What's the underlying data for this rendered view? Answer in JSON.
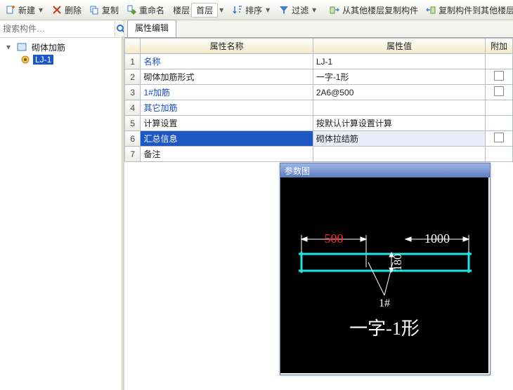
{
  "toolbar": {
    "new": "新建",
    "delete": "删除",
    "copy": "复制",
    "rename": "重命名",
    "floor_label": "楼层",
    "floor_value": "首层",
    "sort": "排序",
    "filter": "过滤",
    "copy_from": "从其他楼层复制构件",
    "copy_to": "复制构件到其他楼层"
  },
  "sidebar": {
    "search_placeholder": "搜索构件…",
    "root": "砌体加筋",
    "item": "LJ-1"
  },
  "tab": {
    "label": "属性编辑"
  },
  "cols": {
    "corner": "",
    "name": "属性名称",
    "value": "属性值",
    "ext": "附加"
  },
  "rows": [
    {
      "n": "1",
      "name": "名称",
      "link": true,
      "value": "LJ-1",
      "chk": false
    },
    {
      "n": "2",
      "name": "砌体加筋形式",
      "link": false,
      "value": "一字-1形",
      "chk": true
    },
    {
      "n": "3",
      "name": "1#加筋",
      "link": true,
      "value": "2A6@500",
      "chk": true
    },
    {
      "n": "4",
      "name": "其它加筋",
      "link": true,
      "value": "",
      "chk": false
    },
    {
      "n": "5",
      "name": "计算设置",
      "link": false,
      "value": "按默认计算设置计算",
      "chk": false
    },
    {
      "n": "6",
      "name": "汇总信息",
      "link": false,
      "value": "砌体拉结筋",
      "chk": true,
      "selected": true
    },
    {
      "n": "7",
      "name": "备注",
      "link": false,
      "value": "",
      "chk": false
    }
  ],
  "param": {
    "title": "参数图",
    "dim_left": "500",
    "dim_right": "1000",
    "dim_h": "180",
    "tag": "1#",
    "caption": "一字-1形"
  }
}
